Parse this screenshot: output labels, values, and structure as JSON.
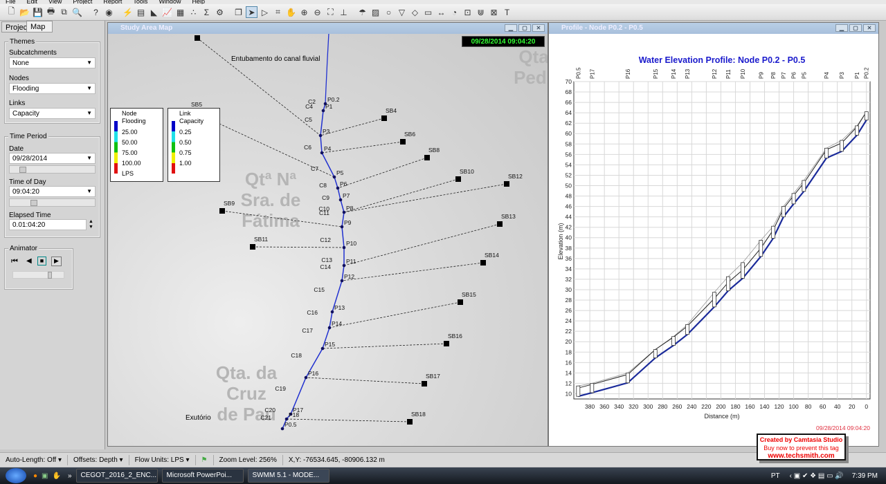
{
  "menu": [
    "File",
    "Edit",
    "View",
    "Project",
    "Report",
    "Tools",
    "Window",
    "Help"
  ],
  "toolbar_icons": [
    "new-icon",
    "open-icon",
    "save-icon",
    "print-icon",
    "copy-icon",
    "find-icon",
    "query-icon",
    "overview-map-icon",
    "run-icon",
    "status-report-icon",
    "profile-plot-icon",
    "time-series-icon",
    "table-icon",
    "scatter-plot-icon",
    "statistics-icon",
    "options-icon",
    "arrange-icon",
    "select-object-icon",
    "select-vertex-icon",
    "select-region-icon",
    "pan-icon",
    "zoom-in-icon",
    "zoom-out-icon",
    "full-extent-icon",
    "measure-icon",
    "rain-gage-icon",
    "subcatchment-icon",
    "junction-icon",
    "outfall-icon",
    "divider-icon",
    "storage-icon",
    "conduit-icon",
    "pump-icon",
    "orifice-icon",
    "weir-icon",
    "outlet-icon",
    "text-icon"
  ],
  "left_panel": {
    "tabs": [
      "Project",
      "Map"
    ],
    "themes": {
      "title": "Themes",
      "subcatchments_label": "Subcatchments",
      "subcatchments_value": "None",
      "nodes_label": "Nodes",
      "nodes_value": "Flooding",
      "links_label": "Links",
      "links_value": "Capacity"
    },
    "time_period": {
      "title": "Time Period",
      "date_label": "Date",
      "date_value": "09/28/2014",
      "time_label": "Time of Day",
      "time_value": "09:04:20",
      "elapsed_label": "Elapsed Time",
      "elapsed_value": "0.01:04:20"
    },
    "animator": {
      "title": "Animator"
    }
  },
  "map": {
    "title": "Study Area Map",
    "datetime": "09/28/2014 09:04:20",
    "annotation": "Entubamento do canal fluvial",
    "outfall_label": "Exutório",
    "place_labels": [
      "Qta. da\nCruz\nde Pau",
      "Qta\nPedr",
      "Qtª Nª\nSra. de\nFátima"
    ],
    "node_legend": {
      "title1": "Node",
      "title2": "Flooding",
      "values": [
        "25.00",
        "50.00",
        "75.00",
        "100.00"
      ],
      "unit": "LPS"
    },
    "link_legend": {
      "title1": "Link",
      "title2": "Capacity",
      "values": [
        "0.25",
        "0.50",
        "0.75",
        "1.00"
      ]
    },
    "legend_colors": [
      "#0000c8",
      "#20e0e8",
      "#10c010",
      "#f0f000",
      "#e01010"
    ],
    "nodes": [
      "P0.2",
      "P1",
      "P3",
      "P4",
      "P5",
      "P6",
      "P7",
      "P8",
      "P9",
      "P10",
      "P11",
      "P12",
      "P13",
      "P14",
      "P15",
      "P16",
      "P17",
      "P18",
      "P0.5"
    ],
    "conduits": [
      "C2",
      "C4",
      "C5",
      "C6",
      "C7",
      "C8",
      "C9",
      "C10",
      "C11",
      "C12",
      "C13",
      "C14",
      "C15",
      "C16",
      "C17",
      "C18",
      "C19",
      "C20",
      "C21"
    ],
    "subcatchments": [
      "",
      "SB4",
      "SB5",
      "SB6",
      "SB8",
      "SB9",
      "SB10",
      "SB11",
      "SB12",
      "SB13",
      "SB14",
      "SB15",
      "SB16",
      "SB17",
      "SB18"
    ]
  },
  "profile": {
    "title": "Profile - Node P0.2 - P0.5"
  },
  "chart_data": {
    "type": "line",
    "title": "Water Elevation Profile:  Node P0.2 - P0.5",
    "xlabel": "Distance (m)",
    "ylabel": "Elevation (m)",
    "xlim": [
      402,
      -5
    ],
    "ylim": [
      9,
      70
    ],
    "xticks": [
      380,
      360,
      340,
      320,
      300,
      280,
      260,
      240,
      220,
      200,
      180,
      160,
      140,
      120,
      100,
      80,
      60,
      40,
      20,
      0
    ],
    "yticks": [
      10,
      12,
      14,
      16,
      18,
      20,
      22,
      24,
      26,
      28,
      30,
      32,
      34,
      36,
      38,
      40,
      42,
      44,
      46,
      48,
      50,
      52,
      54,
      56,
      58,
      60,
      62,
      64,
      66,
      68,
      70
    ],
    "grid": true,
    "nodes": [
      "P0.5",
      "P17",
      "P16",
      "P15",
      "P14",
      "P13",
      "P12",
      "P11",
      "P10",
      "P9",
      "P8",
      "P7",
      "P6",
      "P5",
      "P4",
      "P3",
      "P1",
      "P0.2"
    ],
    "distance": [
      396,
      377,
      328,
      290,
      265,
      246,
      209,
      190,
      170,
      145,
      128,
      114,
      100,
      86,
      55,
      34,
      13,
      0
    ],
    "invert": [
      9.5,
      10.2,
      12.1,
      16.9,
      19.3,
      21.4,
      26.7,
      29.8,
      32.2,
      36.4,
      39.9,
      44,
      46.5,
      48.9,
      55.3,
      56.6,
      59.7,
      62.6
    ],
    "ground": [
      11.5,
      12,
      14,
      18.5,
      21,
      23.3,
      29.5,
      32.5,
      35.2,
      39.5,
      42.2,
      46,
      48.5,
      51,
      57.2,
      58.7,
      61.5,
      64.2
    ],
    "water_color": "#1a2a9a",
    "timestamp": "09/28/2014 09:04:20"
  },
  "statusbar": {
    "auto_length": "Auto-Length: Off",
    "offsets": "Offsets: Depth",
    "flow_units": "Flow Units: LPS",
    "zoom": "Zoom Level: 256%",
    "xy": "X,Y: -76534.645, -80906.132 m"
  },
  "taskbar": {
    "tasks": [
      "CEGOT_2016_2_ENC...",
      "Microsoft PowerPoi...",
      "SWMM 5.1 - MODE..."
    ],
    "lang": "PT",
    "clock": "7:39 PM"
  },
  "watermark": {
    "line1": "Created by Camtasia Studio",
    "line2": "Buy now to prevent this tag",
    "line3": "www.techsmith.com"
  }
}
